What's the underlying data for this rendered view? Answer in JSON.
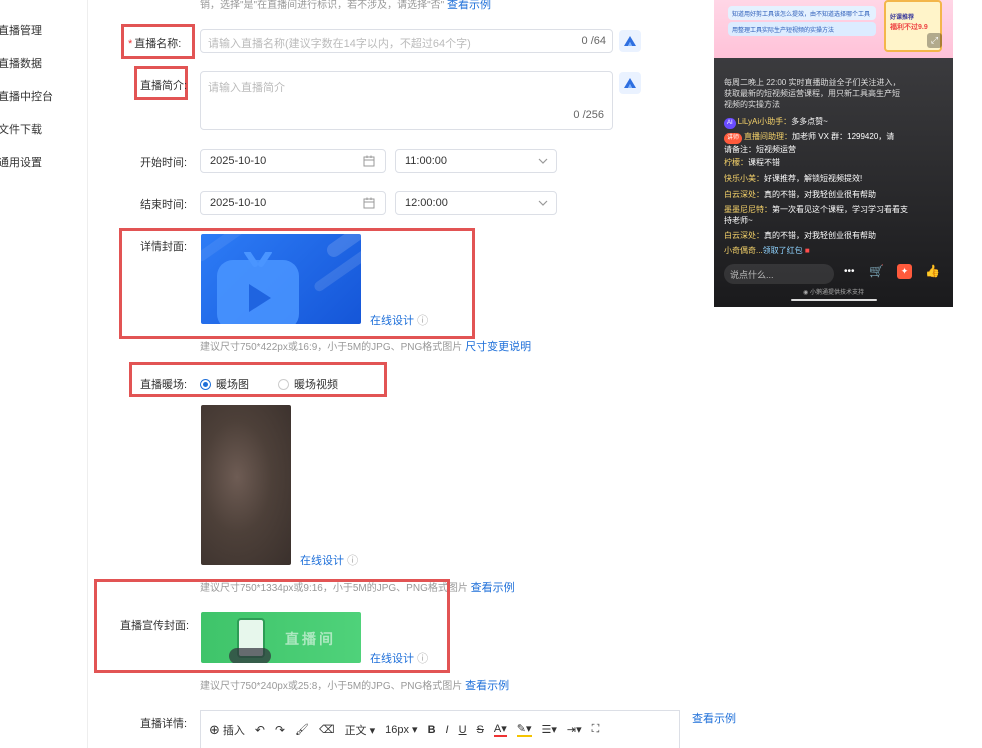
{
  "sidebar": {
    "items": [
      "直播管理",
      "直播数据",
      "直播中控台",
      "文件下载",
      "通用设置"
    ]
  },
  "top_note": {
    "text": "销，选择\"是\"在直播间进行标识，若不涉及，请选择\"否\"",
    "link": "查看示例"
  },
  "form": {
    "name": {
      "label": "直播名称:",
      "required_mark": "*",
      "placeholder": "请输入直播名称(建议字数在14字以内，不超过64个字)",
      "counter": "0 /64"
    },
    "intro": {
      "label": "直播简介:",
      "placeholder": "请输入直播简介",
      "counter": "0 /256"
    },
    "start": {
      "label": "开始时间:",
      "date": "2025-10-10",
      "time": "11:00:00"
    },
    "end": {
      "label": "结束时间:",
      "date": "2025-10-10",
      "time": "12:00:00"
    },
    "detail_cover": {
      "label": "详情封面:",
      "online_design": "在线设计",
      "hint": "建议尺寸750*422px或16:9，小于5M的JPG、PNG格式图片",
      "hint_link": "尺寸变更说明"
    },
    "warmup": {
      "label": "直播暖场:",
      "option_image": "暖场图",
      "option_video": "暖场视频",
      "selected": "暖场图",
      "online_design": "在线设计",
      "hint": "建议尺寸750*1334px或9:16，小于5M的JPG、PNG格式图片",
      "hint_link": "查看示例"
    },
    "promo_cover": {
      "label": "直播宣传封面:",
      "banner_text": "直播间",
      "online_design": "在线设计",
      "hint": "建议尺寸750*240px或25:8，小于5M的JPG、PNG格式图片",
      "hint_link": "查看示例"
    },
    "detail": {
      "label": "直播详情:",
      "view_example": "查看示例"
    }
  },
  "editor_toolbar": {
    "insert": "插入",
    "paragraph": "正文",
    "font_size": "16px",
    "bold": "B",
    "italic": "I",
    "underline": "U",
    "strike": "S",
    "font_color": "A"
  },
  "phone_preview": {
    "chat": [
      {
        "name": "",
        "text": "每周二晚上 22:00 实时直播助益全子们关注进入，获取最新的短视频运营课程，用只新工具高生产短视频的实操方法"
      },
      {
        "tag": "AI",
        "name": "LiLyAi小助手：",
        "text": "多多点赞~"
      },
      {
        "tag": "讲师",
        "name": "直播间助理：",
        "text": "加老师 VX 群：1299420，请请备注：短视频运营"
      },
      {
        "name": "柠檬：",
        "text": "课程不错"
      },
      {
        "name": "快乐小美：",
        "text": "好课推荐，解锁短视频提效!"
      },
      {
        "name": "白云深处：",
        "text": "真的不错，对我轻创业很有帮助"
      },
      {
        "name": "墨墨尼尼特：",
        "text": "第一次看见这个课程，学习学习看看支持老师~"
      },
      {
        "name": "白云深处：",
        "text": "真的不错，对我轻创业很有帮助"
      },
      {
        "name": "小奇偶奇...",
        "text": "领取了红包"
      }
    ],
    "say_placeholder": "说点什么...",
    "footer": "小鹅通提供技术支持",
    "banner_line1": "知道用好剪工具该怎么提效，由不知道选择哪个工具",
    "banner_line2": "用整理工具实际生产短视频的实操方法",
    "badge_line1": "好课推荐",
    "badge_line2": "福利不过9.9"
  },
  "colors": {
    "accent": "#1e6fd9",
    "red_box": "#e25454",
    "required": "#e33333"
  }
}
